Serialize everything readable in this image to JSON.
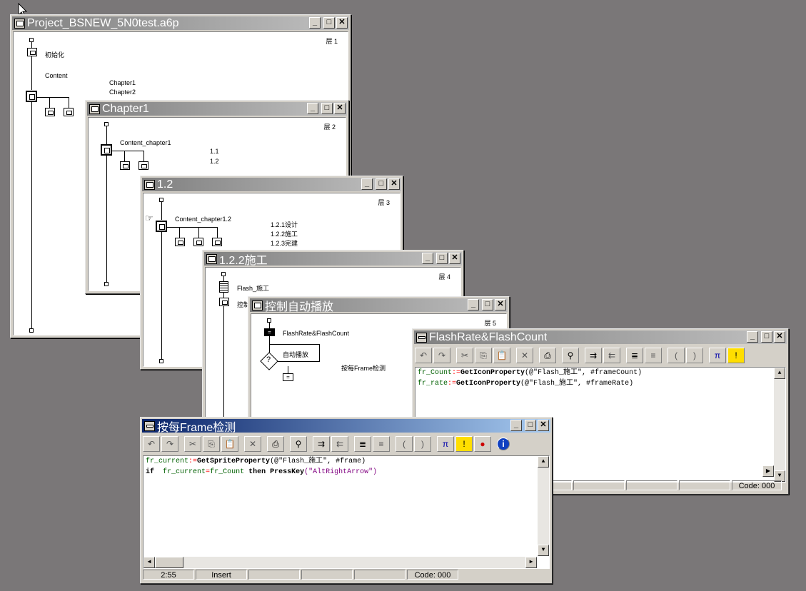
{
  "windows": {
    "project": {
      "title": "Project_BSNEW_5N0test.a6p",
      "layer": "层 1",
      "icon_init": "初始化",
      "framework": "Content",
      "pages": [
        "Chapter1",
        "Chapter2"
      ]
    },
    "chapter1": {
      "title": "Chapter1",
      "layer": "层 2",
      "framework": "Content_chapter1",
      "pages": [
        "1.1",
        "1.2"
      ]
    },
    "w12": {
      "title": "1.2",
      "layer": "层 3",
      "framework": "Content_chapter1.2",
      "pages": [
        "1.2.1设计",
        "1.2.2施工",
        "1.2.3完建"
      ]
    },
    "w122": {
      "title": "1.2.2施工",
      "layer": "层 4",
      "icon_flash": "Flash_施工",
      "icon_ctrl": "控制"
    },
    "ctrl": {
      "title": "控制自动播放",
      "layer": "层 5",
      "icon_calc": "FlashRate&FlashCount",
      "icon_loop": "自动播放",
      "icon_check": "按每Frame检测"
    },
    "calc1": {
      "title": "FlashRate&FlashCount",
      "lines": [
        {
          "var": "fr_Count",
          "op": ":=",
          "fn": "GetIconProperty",
          "args": "(@\"Flash_施工\", #frameCount)"
        },
        {
          "var": "fr_rate",
          "op": ":=",
          "fn": "GetIconProperty",
          "args": "(@\"Flash_施工\", #frameRate)"
        }
      ],
      "status_code": "Code: 000"
    },
    "calc2": {
      "title": "按每Frame检测",
      "line1": {
        "var": "fr_current",
        "op": ":=",
        "fn": "GetSpriteProperty",
        "args": "(@\"Flash_施工\", #frame)"
      },
      "line2": {
        "kw_if": "if",
        "var1": "fr_current",
        "op": "=",
        "var2": "fr_Count",
        "kw_then": "then",
        "fn": "PressKey",
        "args": "(\"AltRightArrow\")"
      },
      "status_pos": "2:55",
      "status_mode": "Insert",
      "status_code": "Code: 000"
    }
  },
  "buttons": {
    "min": "_",
    "max": "□",
    "close": "✕"
  },
  "colors": {
    "desktop": "#7a7778",
    "title_active": "#0a246a",
    "title_inactive": "#808080"
  }
}
